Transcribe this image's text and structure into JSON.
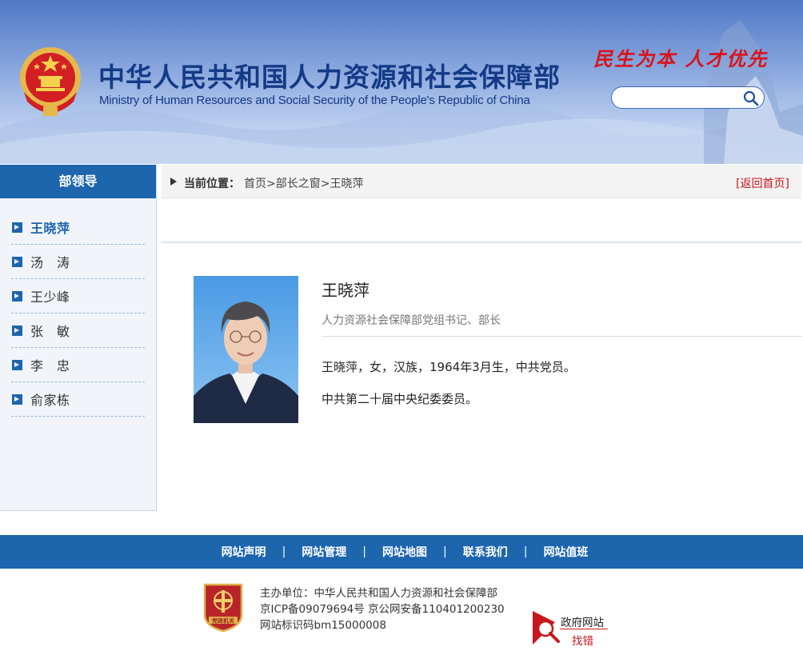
{
  "header": {
    "title_cn": "中华人民共和国人力资源和社会保障部",
    "title_en": "Ministry of Human Resources and Social Security of the People's Republic of China",
    "slogan": "民生为本 人才优先",
    "search": {
      "placeholder": "",
      "value": ""
    }
  },
  "sidebar": {
    "title": "部领导",
    "items": [
      {
        "label": "王晓萍"
      },
      {
        "label": "汤　涛"
      },
      {
        "label": "王少峰"
      },
      {
        "label": "张　敏"
      },
      {
        "label": "李　忠"
      },
      {
        "label": "俞家栋"
      }
    ]
  },
  "breadcrumb": {
    "label": "当前位置：",
    "home": "首页",
    "sep": ">",
    "section": "部长之窗",
    "current": "王晓萍",
    "back": "[返回首页]"
  },
  "profile": {
    "name": "王晓萍",
    "title": "人力资源社会保障部党组书记、部长",
    "bio1": "王晓萍，女，汉族，1964年3月生，中共党员。",
    "bio2": "中共第二十届中央纪委委员。"
  },
  "footer": {
    "nav": [
      {
        "label": "网站声明"
      },
      {
        "label": "网站管理"
      },
      {
        "label": "网站地图"
      },
      {
        "label": "联系我们"
      },
      {
        "label": "网站值班"
      }
    ],
    "nav_separator": "|",
    "host": "主办单位：中华人民共和国人力资源和社会保障部",
    "icp": "京ICP备09079694号 京公网安备110401200230",
    "site_id": "网站标识码bm15000008",
    "party_badge_text": "党政机关",
    "gov_badge_line1": "政府网站",
    "gov_badge_line2": "找错"
  },
  "colors": {
    "primary_blue": "#1d65ad",
    "title_blue": "#143a86",
    "slogan_red": "#d8141b",
    "link_red": "#c8161d"
  },
  "icons": {
    "emblem": "national-emblem-icon",
    "search": "search-icon",
    "bullet": "arrow-right-icon",
    "party": "party-government-badge-icon",
    "gov": "gov-site-error-icon"
  }
}
